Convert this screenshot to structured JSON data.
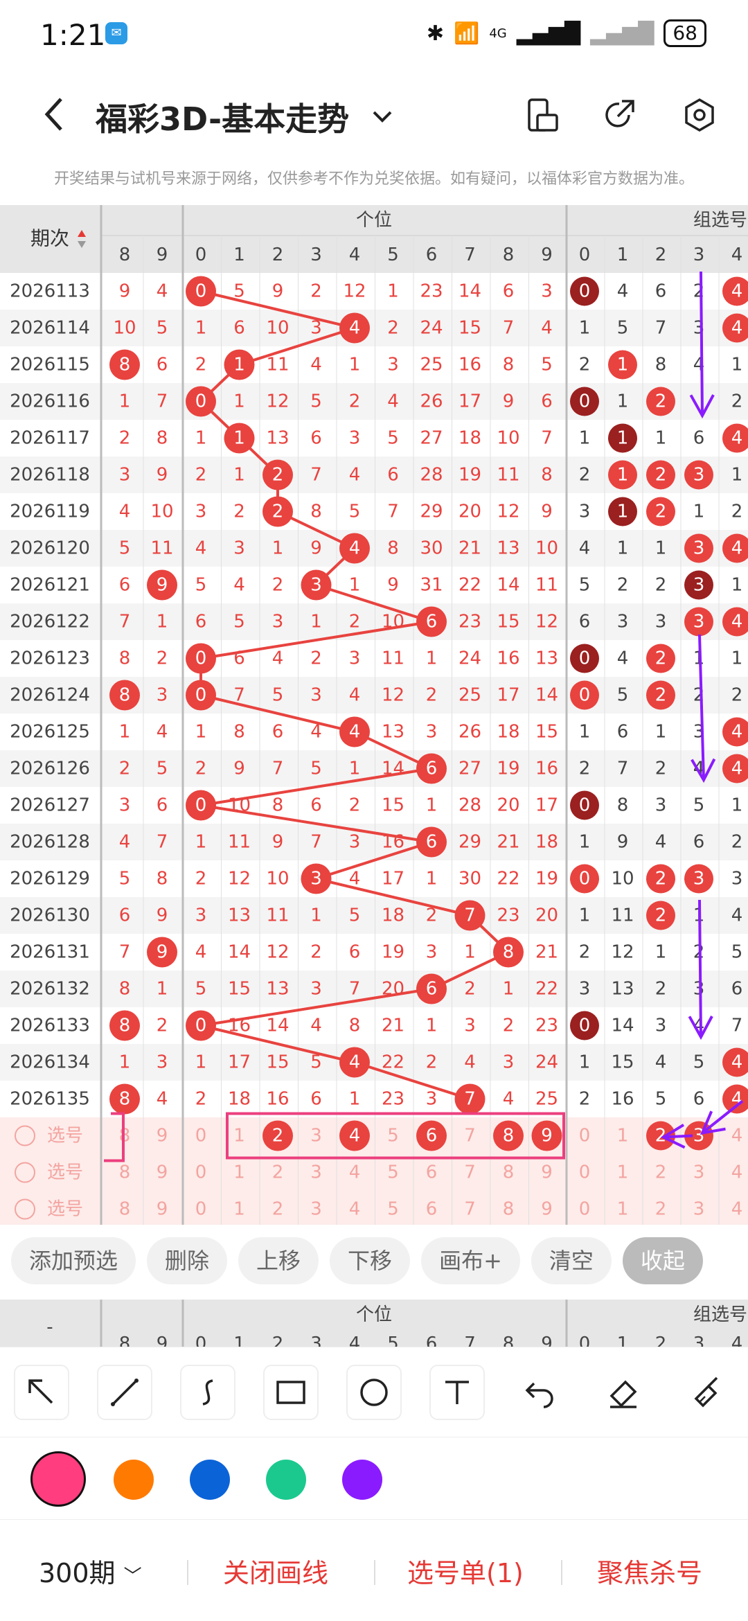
{
  "status": {
    "time": "1:21",
    "battery": "68",
    "network": "4G"
  },
  "header": {
    "title": "福彩3D-基本走势"
  },
  "notice": "开奖结果与试机号来源于网络，仅供参考不作为兑奖依据。如有疑问，以福体彩官方数据为准。",
  "table": {
    "col_issue_label": "期次",
    "group_left_label": "个位",
    "group_right_label": "组选号",
    "prev_digits": [
      "8",
      "9"
    ],
    "digits": [
      "0",
      "1",
      "2",
      "3",
      "4",
      "5",
      "6",
      "7",
      "8",
      "9"
    ],
    "group_digits": [
      "0",
      "1",
      "2",
      "3",
      "4"
    ],
    "rows": [
      {
        "issue": "2026113",
        "prev": [
          "9",
          "4"
        ],
        "cells": [
          "0",
          "5",
          "9",
          "2",
          "12",
          "1",
          "23",
          "14",
          "6",
          "3"
        ],
        "hit": 0,
        "group": [
          "0",
          "4",
          "6",
          "2",
          "4"
        ],
        "ghit": [
          0,
          4
        ],
        "gdark": [
          0
        ]
      },
      {
        "issue": "2026114",
        "prev": [
          "10",
          "5"
        ],
        "cells": [
          "1",
          "6",
          "10",
          "3",
          "4",
          "2",
          "24",
          "15",
          "7",
          "4"
        ],
        "hit": 4,
        "group": [
          "1",
          "5",
          "7",
          "3",
          "4"
        ],
        "ghit": [
          4
        ],
        "gdark": []
      },
      {
        "issue": "2026115",
        "prev": [
          "8",
          "6"
        ],
        "cells": [
          "2",
          "1",
          "11",
          "4",
          "1",
          "3",
          "25",
          "16",
          "8",
          "5"
        ],
        "hit": 1,
        "prevhit": 0,
        "group": [
          "2",
          "1",
          "8",
          "4",
          "1"
        ],
        "ghit": [
          1
        ],
        "gdark": []
      },
      {
        "issue": "2026116",
        "prev": [
          "1",
          "7"
        ],
        "cells": [
          "0",
          "1",
          "12",
          "5",
          "2",
          "4",
          "26",
          "17",
          "9",
          "6"
        ],
        "hit": 0,
        "group": [
          "0",
          "1",
          "2",
          "",
          "2"
        ],
        "ghit": [
          0,
          2
        ],
        "gdark": [
          0
        ]
      },
      {
        "issue": "2026117",
        "prev": [
          "2",
          "8"
        ],
        "cells": [
          "1",
          "1",
          "13",
          "6",
          "3",
          "5",
          "27",
          "18",
          "10",
          "7"
        ],
        "hit": 1,
        "group": [
          "1",
          "1",
          "1",
          "6",
          "4"
        ],
        "ghit": [
          1,
          4
        ],
        "gdark": [
          1
        ]
      },
      {
        "issue": "2026118",
        "prev": [
          "3",
          "9"
        ],
        "cells": [
          "2",
          "1",
          "2",
          "7",
          "4",
          "6",
          "28",
          "19",
          "11",
          "8"
        ],
        "hit": 2,
        "group": [
          "2",
          "1",
          "2",
          "3",
          "1"
        ],
        "ghit": [
          1,
          2,
          3
        ],
        "gdark": []
      },
      {
        "issue": "2026119",
        "prev": [
          "4",
          "10"
        ],
        "cells": [
          "3",
          "2",
          "2",
          "8",
          "5",
          "7",
          "29",
          "20",
          "12",
          "9"
        ],
        "hit": 2,
        "group": [
          "3",
          "1",
          "2",
          "1",
          "2"
        ],
        "ghit": [
          1,
          2
        ],
        "gdark": [
          1
        ]
      },
      {
        "issue": "2026120",
        "prev": [
          "5",
          "11"
        ],
        "cells": [
          "4",
          "3",
          "1",
          "9",
          "4",
          "8",
          "30",
          "21",
          "13",
          "10"
        ],
        "hit": 4,
        "group": [
          "4",
          "1",
          "1",
          "3",
          "4"
        ],
        "ghit": [
          3,
          4
        ],
        "gdark": []
      },
      {
        "issue": "2026121",
        "prev": [
          "6",
          "9"
        ],
        "cells": [
          "5",
          "4",
          "2",
          "3",
          "1",
          "9",
          "31",
          "22",
          "14",
          "11"
        ],
        "hit": 3,
        "prevhit": 1,
        "group": [
          "5",
          "2",
          "2",
          "3",
          "1"
        ],
        "ghit": [
          3
        ],
        "gdark": [
          3
        ]
      },
      {
        "issue": "2026122",
        "prev": [
          "7",
          "1"
        ],
        "cells": [
          "6",
          "5",
          "3",
          "1",
          "2",
          "10",
          "6",
          "23",
          "15",
          "12"
        ],
        "hit": 6,
        "group": [
          "6",
          "3",
          "3",
          "3",
          "4"
        ],
        "ghit": [
          3,
          4
        ],
        "gdark": []
      },
      {
        "issue": "2026123",
        "prev": [
          "8",
          "2"
        ],
        "cells": [
          "0",
          "6",
          "4",
          "2",
          "3",
          "11",
          "1",
          "24",
          "16",
          "13"
        ],
        "hit": 0,
        "group": [
          "0",
          "4",
          "2",
          "1",
          "1"
        ],
        "ghit": [
          0,
          2
        ],
        "gdark": [
          0
        ]
      },
      {
        "issue": "2026124",
        "prev": [
          "8",
          "3"
        ],
        "cells": [
          "0",
          "7",
          "5",
          "3",
          "4",
          "12",
          "2",
          "25",
          "17",
          "14"
        ],
        "hit": 0,
        "prevhit": 0,
        "group": [
          "0",
          "5",
          "2",
          "2",
          "2"
        ],
        "ghit": [
          0,
          2
        ],
        "gdark": []
      },
      {
        "issue": "2026125",
        "prev": [
          "1",
          "4"
        ],
        "cells": [
          "1",
          "8",
          "6",
          "4",
          "4",
          "13",
          "3",
          "26",
          "18",
          "15"
        ],
        "hit": 4,
        "group": [
          "1",
          "6",
          "1",
          "3",
          "4"
        ],
        "ghit": [
          4
        ],
        "gdark": []
      },
      {
        "issue": "2026126",
        "prev": [
          "2",
          "5"
        ],
        "cells": [
          "2",
          "9",
          "7",
          "5",
          "1",
          "14",
          "6",
          "27",
          "19",
          "16"
        ],
        "hit": 6,
        "group": [
          "2",
          "7",
          "2",
          "4",
          "4"
        ],
        "ghit": [
          4
        ],
        "gdark": []
      },
      {
        "issue": "2026127",
        "prev": [
          "3",
          "6"
        ],
        "cells": [
          "0",
          "10",
          "8",
          "6",
          "2",
          "15",
          "1",
          "28",
          "20",
          "17"
        ],
        "hit": 0,
        "group": [
          "0",
          "8",
          "3",
          "5",
          "1"
        ],
        "ghit": [
          0
        ],
        "gdark": [
          0
        ]
      },
      {
        "issue": "2026128",
        "prev": [
          "4",
          "7"
        ],
        "cells": [
          "1",
          "11",
          "9",
          "7",
          "3",
          "16",
          "6",
          "29",
          "21",
          "18"
        ],
        "hit": 6,
        "group": [
          "1",
          "9",
          "4",
          "6",
          "2"
        ],
        "ghit": [],
        "gdark": []
      },
      {
        "issue": "2026129",
        "prev": [
          "5",
          "8"
        ],
        "cells": [
          "2",
          "12",
          "10",
          "3",
          "4",
          "17",
          "1",
          "30",
          "22",
          "19"
        ],
        "hit": 3,
        "group": [
          "0",
          "10",
          "2",
          "3",
          "3"
        ],
        "ghit": [
          0,
          2,
          3
        ],
        "gdark": []
      },
      {
        "issue": "2026130",
        "prev": [
          "6",
          "9"
        ],
        "cells": [
          "3",
          "13",
          "11",
          "1",
          "5",
          "18",
          "2",
          "7",
          "23",
          "20"
        ],
        "hit": 7,
        "group": [
          "1",
          "11",
          "2",
          "1",
          "4"
        ],
        "ghit": [
          2
        ],
        "gdark": []
      },
      {
        "issue": "2026131",
        "prev": [
          "7",
          "9"
        ],
        "cells": [
          "4",
          "14",
          "12",
          "2",
          "6",
          "19",
          "3",
          "1",
          "8",
          "21"
        ],
        "hit": 8,
        "prevhit": 1,
        "group": [
          "2",
          "12",
          "1",
          "2",
          "5"
        ],
        "ghit": [],
        "gdark": []
      },
      {
        "issue": "2026132",
        "prev": [
          "8",
          "1"
        ],
        "cells": [
          "5",
          "15",
          "13",
          "3",
          "7",
          "20",
          "6",
          "2",
          "1",
          "22"
        ],
        "hit": 6,
        "group": [
          "3",
          "13",
          "2",
          "3",
          "6"
        ],
        "ghit": [],
        "gdark": []
      },
      {
        "issue": "2026133",
        "prev": [
          "8",
          "2"
        ],
        "cells": [
          "0",
          "16",
          "14",
          "4",
          "8",
          "21",
          "1",
          "3",
          "2",
          "23"
        ],
        "hit": 0,
        "prevhit": 0,
        "group": [
          "0",
          "14",
          "3",
          "4",
          "7"
        ],
        "ghit": [
          0
        ],
        "gdark": [
          0
        ]
      },
      {
        "issue": "2026134",
        "prev": [
          "1",
          "3"
        ],
        "cells": [
          "1",
          "17",
          "15",
          "5",
          "4",
          "22",
          "2",
          "4",
          "3",
          "24"
        ],
        "hit": 4,
        "group": [
          "1",
          "15",
          "4",
          "5",
          "4"
        ],
        "ghit": [
          4
        ],
        "gdark": []
      },
      {
        "issue": "2026135",
        "prev": [
          "8",
          "4"
        ],
        "cells": [
          "2",
          "18",
          "16",
          "6",
          "1",
          "23",
          "3",
          "7",
          "4",
          "25"
        ],
        "hit": 7,
        "prevhit": 0,
        "group": [
          "2",
          "16",
          "5",
          "6",
          "4"
        ],
        "ghit": [
          4
        ],
        "gdark": []
      }
    ],
    "select_rows": [
      {
        "label": "选号",
        "sel": [
          2,
          4,
          6,
          8,
          9
        ],
        "gsel": [
          2,
          3
        ]
      },
      {
        "label": "选号",
        "sel": [],
        "gsel": []
      },
      {
        "label": "选号",
        "sel": [],
        "gsel": []
      }
    ]
  },
  "toolbar": {
    "buttons": [
      "添加预选",
      "删除",
      "上移",
      "下移",
      "画布+",
      "清空",
      "收起"
    ]
  },
  "draw_tools": [
    "pointer-icon",
    "line-icon",
    "curve-icon",
    "rectangle-icon",
    "circle-icon",
    "text-icon",
    "undo-icon",
    "eraser-icon",
    "clear-brush-icon"
  ],
  "colors": [
    "#ff3d7f",
    "#ff7a00",
    "#0b63d8",
    "#1bc98e",
    "#8a1bff"
  ],
  "bottom_bar": {
    "period": "300期",
    "btn1": "关闭画线",
    "btn2": "选号单(1)",
    "btn3": "聚焦杀号"
  }
}
